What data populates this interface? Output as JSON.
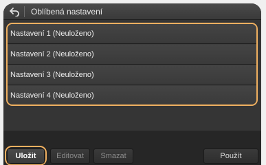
{
  "header": {
    "back_icon": "back-arrow-icon",
    "title": "Oblíbená nastavení"
  },
  "list": {
    "items": [
      {
        "label": "Nastavení 1 (Neuloženo)"
      },
      {
        "label": "Nastavení 2 (Neuloženo)"
      },
      {
        "label": "Nastavení 3 (Neuloženo)"
      },
      {
        "label": "Nastavení 4 (Neuloženo)"
      }
    ]
  },
  "toolbar": {
    "save_label": "Uložit",
    "edit_label": "Editovat",
    "delete_label": "Smazat",
    "use_label": "Použít"
  },
  "colors": {
    "highlight": "#f0b060",
    "panel": "#2b2b2b"
  }
}
